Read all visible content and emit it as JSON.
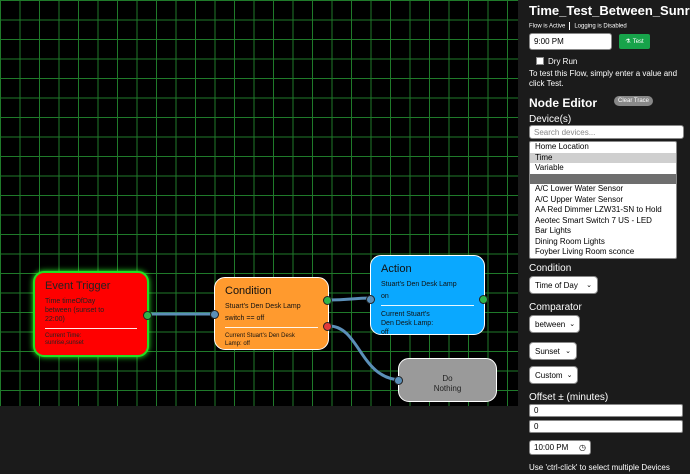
{
  "flow": {
    "title": "Time_Test_Between_Sunrise",
    "status_active": "Flow is Active",
    "status_logging": "Logging is Disabled",
    "test_value": "9:00 PM",
    "test_button": "Test",
    "dry_run_label": "Dry Run",
    "instructions_line1": "To test this Flow, simply enter a value and",
    "instructions_line2": "click Test."
  },
  "node_editor": {
    "title": "Node Editor",
    "clear_trace": "Clear Trace",
    "devices_label": "Device(s)",
    "search_placeholder": "Search devices...",
    "devices": [
      "Home Location",
      "Time",
      "Variable",
      "",
      "A/C Lower Water Sensor",
      "A/C Upper Water Sensor",
      "AA Red Dimmer LZW31-SN to Hold",
      "Aeotec Smart Switch 7 US - LED",
      "Bar Lights",
      "Dining Room Lights",
      "Foyber Living Room sconce"
    ],
    "condition_label": "Condition",
    "condition_value": "Time of Day",
    "comparator_label": "Comparator",
    "comparator_value": "between",
    "sunset_value": "Sunset",
    "custom_value": "Custom",
    "offset_label": "Offset ± (minutes)",
    "offset1": "0",
    "offset2": "0",
    "time_value": "10:00 PM",
    "footer_hint": "Use 'ctrl-click' to select multiple Devices"
  },
  "nodes": {
    "trigger": {
      "title": "Event Trigger",
      "line1": "Time timeOfDay",
      "line2": "between (sunset to",
      "line3": "22:00)",
      "current1": "Current Time:",
      "current2": "sunrise,sunset"
    },
    "condition": {
      "title": "Condition",
      "line1": "Stuart's Den Desk Lamp",
      "line2": "switch == off",
      "current1": "Current Stuart's Den Desk",
      "current2": "Lamp: off"
    },
    "action": {
      "title": "Action",
      "line1": "Stuart's Den Desk Lamp",
      "line2": "on",
      "current1": "Current Stuart's",
      "current2": "Den Desk Lamp:",
      "current3": "off"
    },
    "donothing": {
      "line1": "Do",
      "line2": "Nothing"
    }
  },
  "colors": {
    "trigger": "#ff0000",
    "condition": "#ff9a2e",
    "action": "#0aa8ff",
    "donothing": "#9a9a9a",
    "grid": "#1f7a2a",
    "wire": "#5b8fb8"
  }
}
